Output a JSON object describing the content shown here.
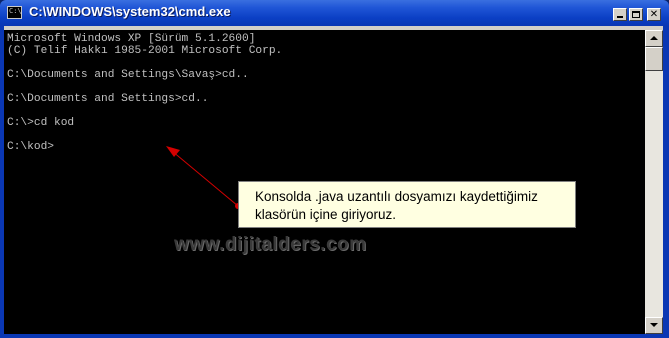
{
  "window": {
    "title": "C:\\WINDOWS\\system32\\cmd.exe",
    "icon": "cmd-icon",
    "icon_text": "C:\\"
  },
  "titlebar_buttons": {
    "minimize": "minimize-icon",
    "maximize": "maximize-icon",
    "close_label": "✕"
  },
  "console": {
    "lines": [
      "Microsoft Windows XP [Sürüm 5.1.2600]",
      "(C) Telif Hakkı 1985-2001 Microsoft Corp.",
      "",
      "C:\\Documents and Settings\\Savaş>cd..",
      "",
      "C:\\Documents and Settings>cd..",
      "",
      "C:\\>cd kod",
      "",
      "C:\\kod>"
    ]
  },
  "callout": {
    "text": "Konsolda .java uzantılı dosyamızı kaydettiğimiz klasörün içine giriyoruz."
  },
  "watermark": {
    "text": "www.dijitalders.com"
  },
  "colors": {
    "titlebar": "#0b3fc4",
    "console_bg": "#000000",
    "console_text": "#c0c0c0",
    "callout_bg": "#ffffe1",
    "arrow": "#d40000"
  }
}
